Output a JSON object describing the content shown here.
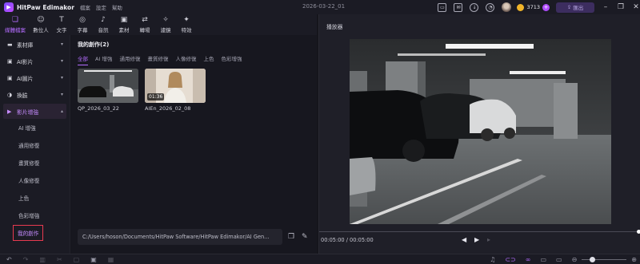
{
  "app": {
    "name": "HitPaw Edimakor",
    "menus": [
      "檔案",
      "設定",
      "幫助"
    ],
    "document_title": "2026-03-22_01",
    "credits": "3713",
    "export_label": "匯出"
  },
  "toolbar": {
    "items": [
      {
        "label": "媒體檔案",
        "icon": "folder-icon"
      },
      {
        "label": "數位人",
        "icon": "avatar-person-icon"
      },
      {
        "label": "文字",
        "icon": "text-icon"
      },
      {
        "label": "字幕",
        "icon": "subtitle-icon"
      },
      {
        "label": "音訊",
        "icon": "music-icon"
      },
      {
        "label": "素材",
        "icon": "sticker-icon"
      },
      {
        "label": "轉場",
        "icon": "transition-icon"
      },
      {
        "label": "濾鏡",
        "icon": "filter-icon"
      },
      {
        "label": "特效",
        "icon": "effects-icon"
      }
    ]
  },
  "sidebar": {
    "items": [
      {
        "label": "素材庫",
        "icon": "folder-icon"
      },
      {
        "label": "AI影片",
        "icon": "ai-video-icon"
      },
      {
        "label": "AI圖片",
        "icon": "ai-image-icon"
      },
      {
        "label": "換臉",
        "icon": "face-swap-icon"
      },
      {
        "label": "影片增強",
        "icon": "enhance-icon"
      }
    ],
    "sub_items": [
      "AI 增強",
      "通用修復",
      "畫質修復",
      "人像修復",
      "上色",
      "色彩增強",
      "我的創作"
    ]
  },
  "media": {
    "title": "我的創作(2)",
    "filters": [
      "全部",
      "AI 增強",
      "通用修復",
      "畫質修復",
      "人像修復",
      "上色",
      "色彩增強"
    ],
    "items": [
      {
        "name": "QP_2026_03_22",
        "duration": ""
      },
      {
        "name": "AIEn_2026_02_08",
        "duration": "01:36"
      }
    ],
    "path": "C:/Users/hoson/Documents/HitPaw Software/HitPaw Edimakor/AI Gen..."
  },
  "player": {
    "title": "播放器",
    "time": "00:05:00 / 00:05:00",
    "progress": 1.0
  },
  "colors": {
    "accent": "#b46cff",
    "highlight_box": "#e83a50"
  }
}
